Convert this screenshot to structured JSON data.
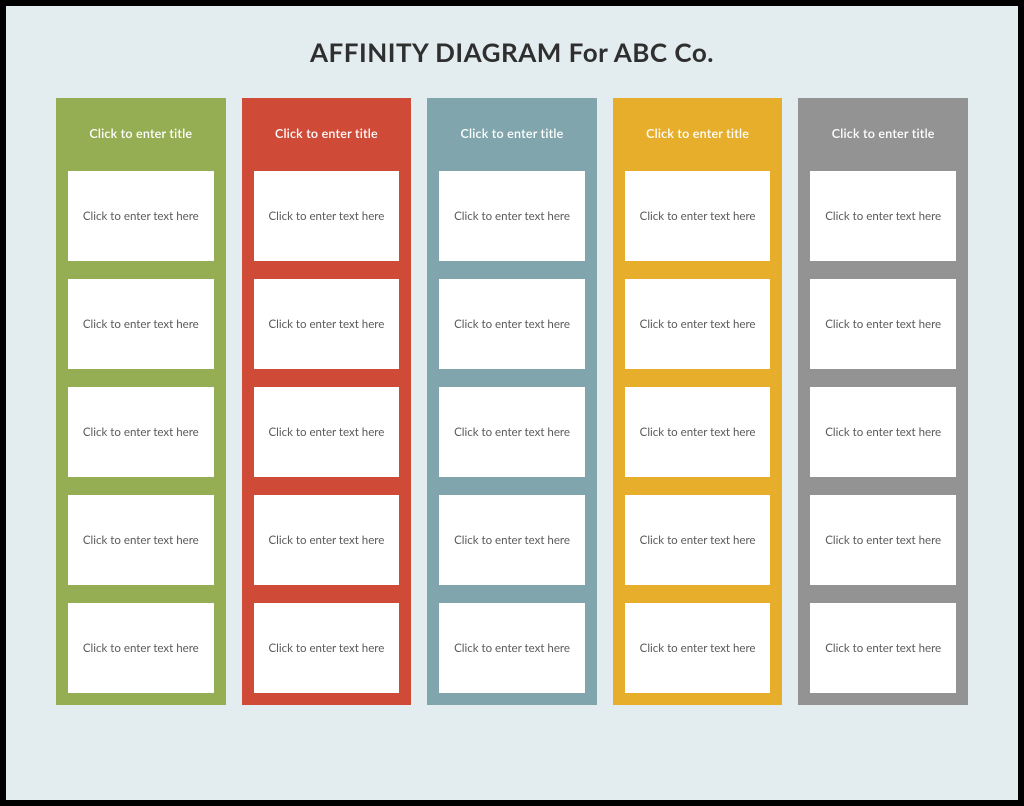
{
  "title": "AFFINITY DIAGRAM For ABC Co.",
  "columns": [
    {
      "color": "#95ae54",
      "title": "Click to enter title",
      "cards": [
        "Click to enter text here",
        "Click to enter text here",
        "Click to enter text here",
        "Click to enter text here",
        "Click to enter text here"
      ]
    },
    {
      "color": "#cf4b38",
      "title": "Click to enter title",
      "cards": [
        "Click to enter text here",
        "Click to enter text here",
        "Click to enter text here",
        "Click to enter text here",
        "Click to enter text here"
      ]
    },
    {
      "color": "#80a5ac",
      "title": "Click to enter title",
      "cards": [
        "Click to enter text here",
        "Click to enter text here",
        "Click to enter text here",
        "Click to enter text here",
        "Click to enter text here"
      ]
    },
    {
      "color": "#e7ae2c",
      "title": "Click to enter title",
      "cards": [
        "Click to enter text here",
        "Click to enter text here",
        "Click to enter text here",
        "Click to enter text here",
        "Click to enter text here"
      ]
    },
    {
      "color": "#939393",
      "title": "Click to enter title",
      "cards": [
        "Click to enter text here",
        "Click to enter text here",
        "Click to enter text here",
        "Click to enter text here",
        "Click to enter text here"
      ]
    }
  ]
}
